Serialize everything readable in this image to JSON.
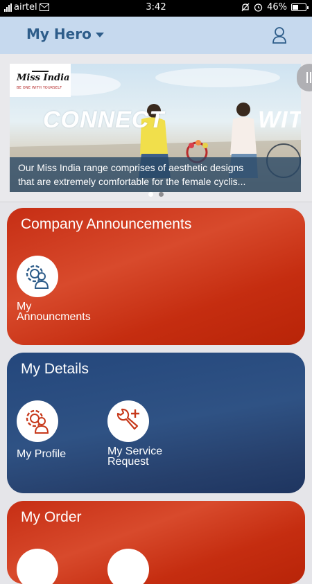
{
  "status_bar": {
    "carrier": "airtel",
    "time": "3:42",
    "battery": "46%",
    "battery_level": 0.46
  },
  "app_bar": {
    "title": "My Hero",
    "dropdown_icon": "caret-down-icon",
    "profile_icon": "user-icon"
  },
  "banner": {
    "logo_text": "Miss India",
    "logo_tagline": "BE ONE WITH YOURSELF",
    "headline_left": "CONNECT",
    "headline_right": "WITH",
    "caption_line1": "Our Miss India range comprises of aesthetic designs",
    "caption_line2": "that are extremely comfortable for the female cyclis...",
    "slides": 2,
    "active_slide": 2
  },
  "sections": {
    "announcements": {
      "title": "Company Announcements",
      "items": [
        {
          "label_line1": "My",
          "label_line2": "Announcments",
          "icon": "gear-user-icon"
        }
      ]
    },
    "details": {
      "title": "My Details",
      "items": [
        {
          "label_line1": "My Profile",
          "label_line2": "",
          "icon": "gear-user-icon"
        },
        {
          "label_line1": "My Service",
          "label_line2": "Request",
          "icon": "wrench-plus-icon"
        }
      ]
    },
    "order": {
      "title": "My Order"
    }
  },
  "colors": {
    "app_bar": "#c6d9ee",
    "title": "#2e5d8a",
    "red_card": "#c62e14",
    "blue_card": "#24477c",
    "icon_accent": "#c7391b"
  }
}
